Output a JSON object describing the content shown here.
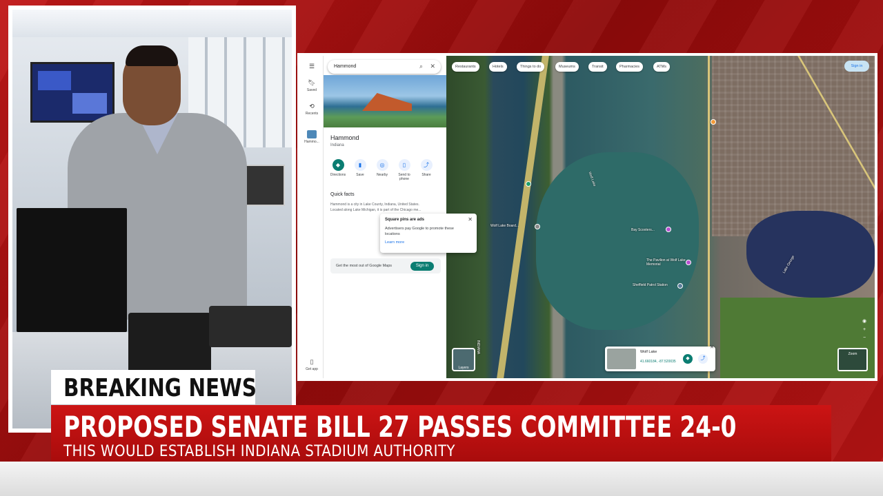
{
  "lower_third": {
    "tag": "BREAKING NEWS",
    "headline": "PROPOSED SENATE BILL 27 PASSES COMMITTEE 24-0",
    "subhead": "THIS WOULD ESTABLISH INDIANA STADIUM AUTHORITY"
  },
  "maps": {
    "search_value": "Hammond",
    "rail": {
      "saved": "Saved",
      "recents": "Recents",
      "recent_item": "Hammo...",
      "get_app": "Get app"
    },
    "place": {
      "title": "Hammond",
      "subtitle": "Indiana"
    },
    "actions": [
      "Directions",
      "Save",
      "Nearby",
      "Send to phone",
      "Share"
    ],
    "quick_facts_title": "Quick facts",
    "quick_facts_text": "Hammond is a city in Lake County, Indiana, United States. Located along Lake Michigan, it is part of the Chicago me...",
    "tooltip": {
      "title": "Square pins are ads",
      "body": "Advertisers pay Google to promote these locations",
      "link": "Learn more"
    },
    "get_most": "Get the most out of Google Maps",
    "get_most_button": "Sign in",
    "chips": [
      "Restaurants",
      "Hotels",
      "Things to do",
      "Museums",
      "Transit",
      "Pharmacies",
      "ATMs"
    ],
    "sign_in": "Sign in",
    "layers_label": "Layers",
    "zoom_label": "Zoom",
    "info_card": {
      "title": "Wolf Lake",
      "coords": "41.660184, -87.520035"
    },
    "map_labels": {
      "wolf_lake": "Wolf Lake",
      "wolf_lake_board": "Wolf Lake Board...",
      "bay_scooters": "Bay Scooters...",
      "pavilion": "The Pavilion at Wolf Lake Memorial",
      "sheffield": "Sheffield Patrol Station",
      "lake_george": "Lake George",
      "indiana": "INDIANA"
    }
  },
  "colors": {
    "brand_red": "#c01818",
    "maps_teal": "#0b7d72"
  }
}
